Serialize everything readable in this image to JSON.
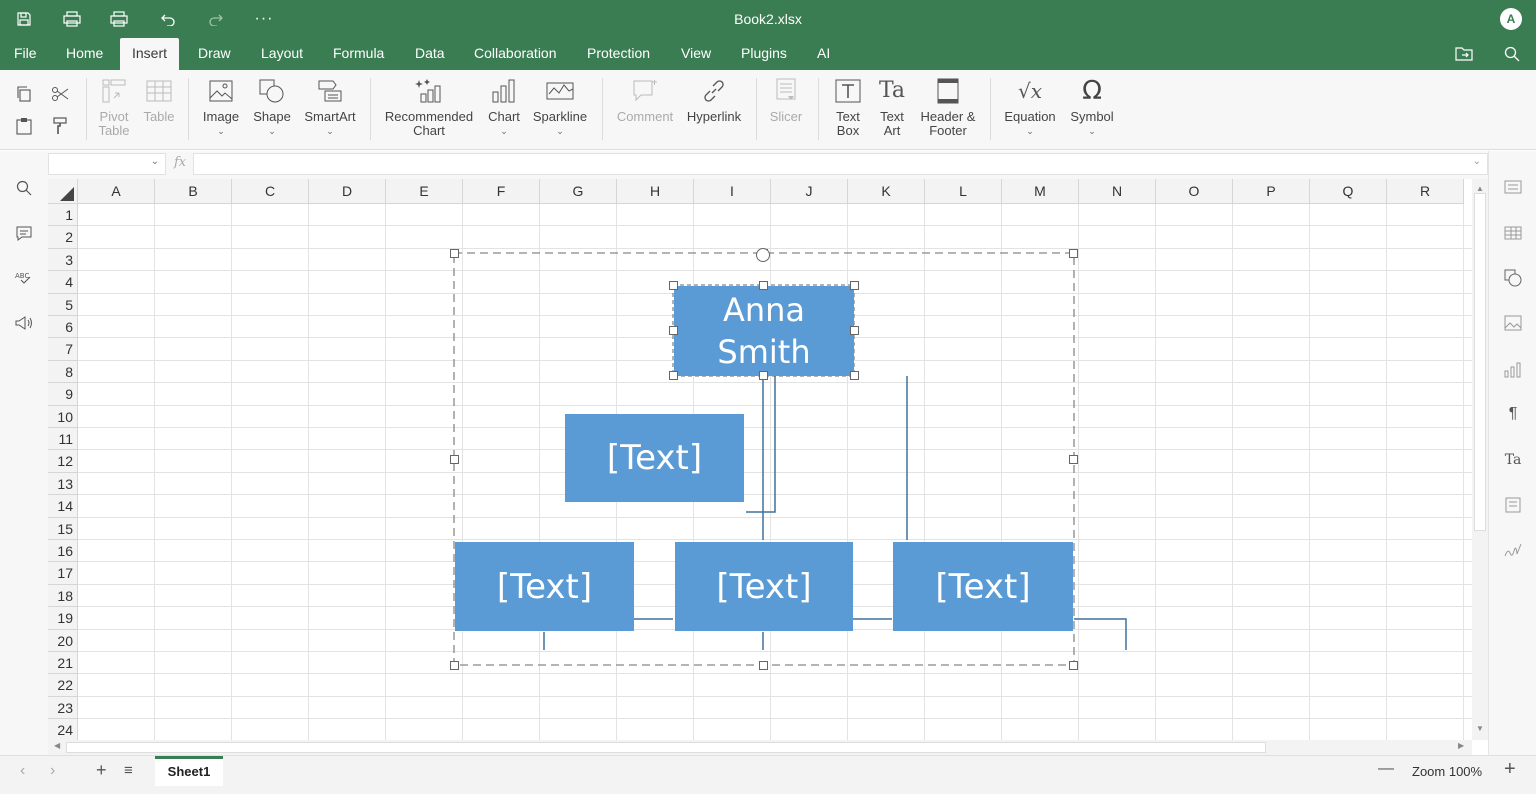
{
  "window": {
    "title": "Book2.xlsx",
    "avatar_initial": "A"
  },
  "menu_tabs": [
    "File",
    "Home",
    "Insert",
    "Draw",
    "Layout",
    "Formula",
    "Data",
    "Collaboration",
    "Protection",
    "View",
    "Plugins",
    "AI"
  ],
  "active_tab": "Insert",
  "ribbon": {
    "pivot_table": "Pivot\nTable",
    "table": "Table",
    "image": "Image",
    "shape": "Shape",
    "smartart": "SmartArt",
    "recommended_chart": "Recommended\nChart",
    "chart": "Chart",
    "sparkline": "Sparkline",
    "comment": "Comment",
    "hyperlink": "Hyperlink",
    "slicer": "Slicer",
    "text_box": "Text\nBox",
    "text_art": "Text\nArt",
    "header_footer": "Header &\nFooter",
    "equation": "Equation",
    "symbol": "Symbol"
  },
  "formula_bar": {
    "fx_label": "fx",
    "name_box": "",
    "formula": ""
  },
  "columns": [
    "A",
    "B",
    "C",
    "D",
    "E",
    "F",
    "G",
    "H",
    "I",
    "J",
    "K",
    "L",
    "M",
    "N",
    "O",
    "P",
    "Q",
    "R"
  ],
  "rows": [
    "1",
    "2",
    "3",
    "4",
    "5",
    "6",
    "7",
    "8",
    "9",
    "10",
    "11",
    "12",
    "13",
    "14",
    "15",
    "16",
    "17",
    "18",
    "19",
    "20",
    "21",
    "22",
    "23",
    "24"
  ],
  "smartart": {
    "top_name": "Anna\nSmith",
    "assistant_text": "[Text]",
    "child_1": "[Text]",
    "child_2": "[Text]",
    "child_3": "[Text]",
    "fill_color": "#5b9bd5"
  },
  "status": {
    "sheet_name": "Sheet1",
    "zoom_label": "Zoom 100%"
  },
  "colors": {
    "accent": "#3a7d52"
  }
}
